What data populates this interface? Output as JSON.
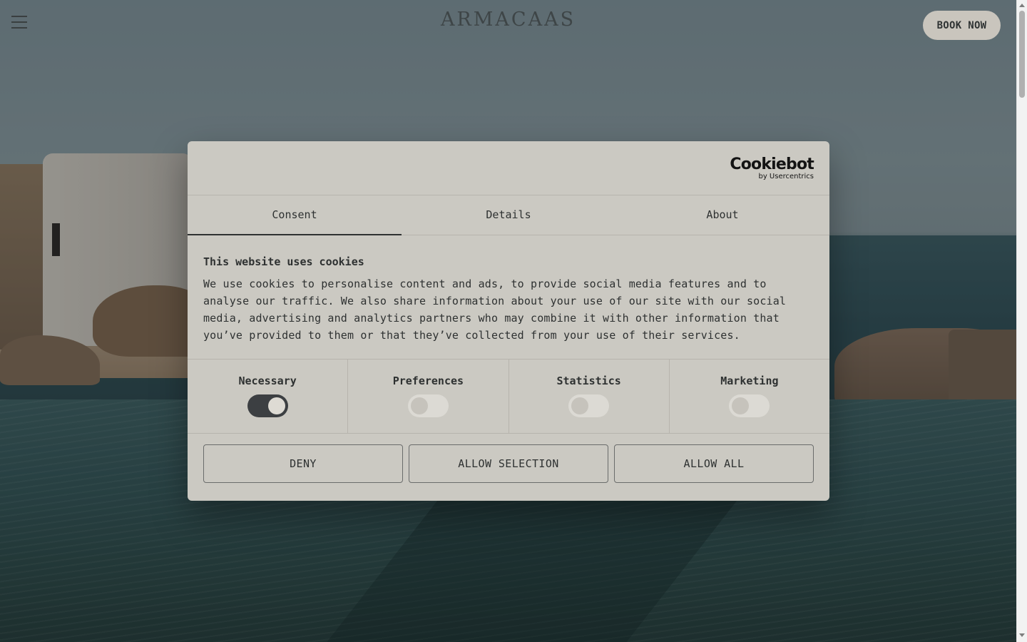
{
  "header": {
    "logo": "ARMACAAS",
    "book_now": "BOOK NOW"
  },
  "cookie_dialog": {
    "brand": {
      "name": "Cookiebot",
      "sub": "by Usercentrics"
    },
    "tabs": [
      {
        "label": "Consent",
        "active": true
      },
      {
        "label": "Details",
        "active": false
      },
      {
        "label": "About",
        "active": false
      }
    ],
    "title": "This website uses cookies",
    "description": "We use cookies to personalise content and ads, to provide social media features and to analyse our traffic. We also share information about your use of our site with our social media, advertising and analytics partners who may combine it with other information that you’ve provided to them or that they’ve collected from your use of their services.",
    "categories": [
      {
        "label": "Necessary",
        "enabled": true
      },
      {
        "label": "Preferences",
        "enabled": false
      },
      {
        "label": "Statistics",
        "enabled": false
      },
      {
        "label": "Marketing",
        "enabled": false
      }
    ],
    "buttons": {
      "deny": "DENY",
      "allow_selection": "ALLOW SELECTION",
      "allow_all": "ALLOW ALL"
    }
  },
  "colors": {
    "dialog_bg": "#cbc9c2",
    "toggle_on": "#3c3f42",
    "text": "#2e3131"
  }
}
